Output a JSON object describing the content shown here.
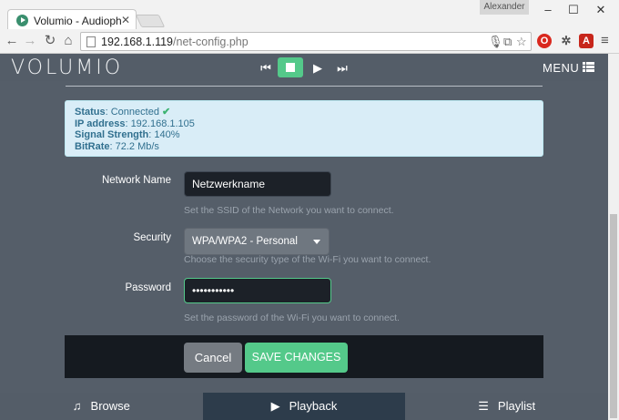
{
  "browser": {
    "tab_title": "Volumio - Audiophile Music Player",
    "user": "Alexander",
    "url_host": "192.168.1.119",
    "url_path": "/net-config.php"
  },
  "app": {
    "logo": "VOLUMIO",
    "menu_label": "MENU"
  },
  "status": {
    "status_label": "Status",
    "status_value": ": Connected",
    "ip_label": "IP address",
    "ip_value": ": 192.168.1.105",
    "signal_label": "Signal Strength",
    "signal_value": ": 140%",
    "bitrate_label": "BitRate",
    "bitrate_value": ": 72.2 Mb/s"
  },
  "form": {
    "network_name_label": "Network Name",
    "network_name_value": "Netzwerkname",
    "network_name_help": "Set the SSID of the Network you want to connect.",
    "security_label": "Security",
    "security_value": "WPA/WPA2 - Personal",
    "security_help": "Choose the security type of the Wi-Fi you want to connect.",
    "password_label": "Password",
    "password_value": "•••••••••••",
    "password_help": "Set the password of the Wi-Fi you want to connect.",
    "cancel_label": "Cancel",
    "save_label": "SAVE CHANGES"
  },
  "bottom_nav": {
    "browse": "Browse",
    "playback": "Playback",
    "playlist": "Playlist"
  },
  "colors": {
    "accent": "#54c98a",
    "background": "#555e69",
    "active_nav": "#2d3c4b"
  }
}
